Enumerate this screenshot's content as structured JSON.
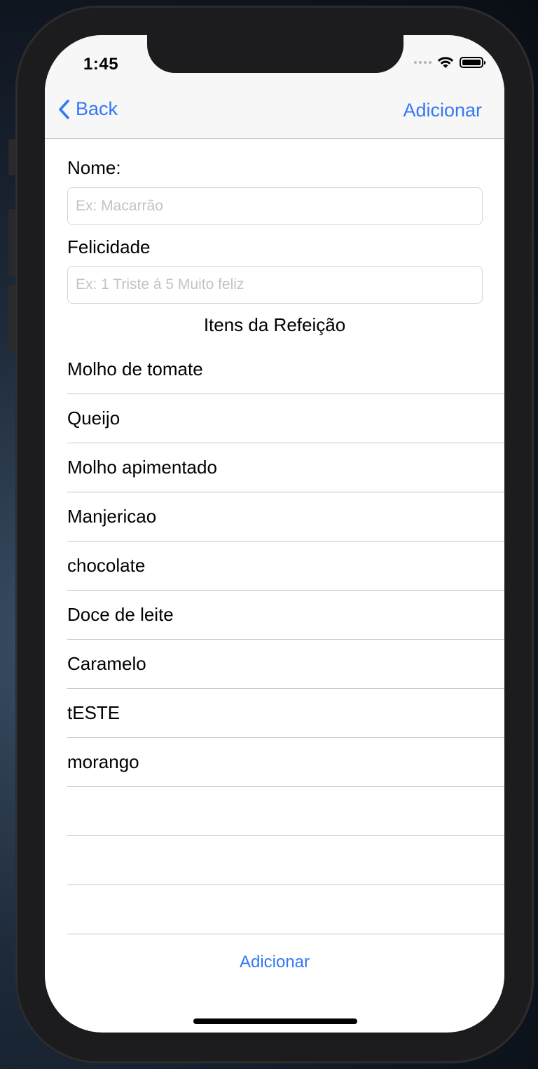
{
  "status_bar": {
    "time": "1:45",
    "icons": [
      "signal-dots-icon",
      "wifi-icon",
      "battery-icon"
    ]
  },
  "nav": {
    "back_label": "Back",
    "add_label": "Adicionar"
  },
  "form": {
    "name_label": "Nome:",
    "name_placeholder": "Ex: Macarrão",
    "name_value": "",
    "happiness_label": "Felicidade",
    "happiness_placeholder": "Ex: 1 Triste á 5 Muito feliz",
    "happiness_value": ""
  },
  "items_section": {
    "title": "Itens da Refeição",
    "items": [
      "Molho de tomate",
      "Queijo",
      "Molho apimentado",
      "Manjericao",
      "chocolate",
      "Doce de leite",
      "Caramelo",
      "tESTE",
      "morango"
    ]
  },
  "footer": {
    "add_label": "Adicionar"
  },
  "colors": {
    "accent": "#3478f6",
    "separator": "#c8c8cc",
    "nav_background": "#f7f7f7",
    "placeholder": "#c3c3c7"
  }
}
